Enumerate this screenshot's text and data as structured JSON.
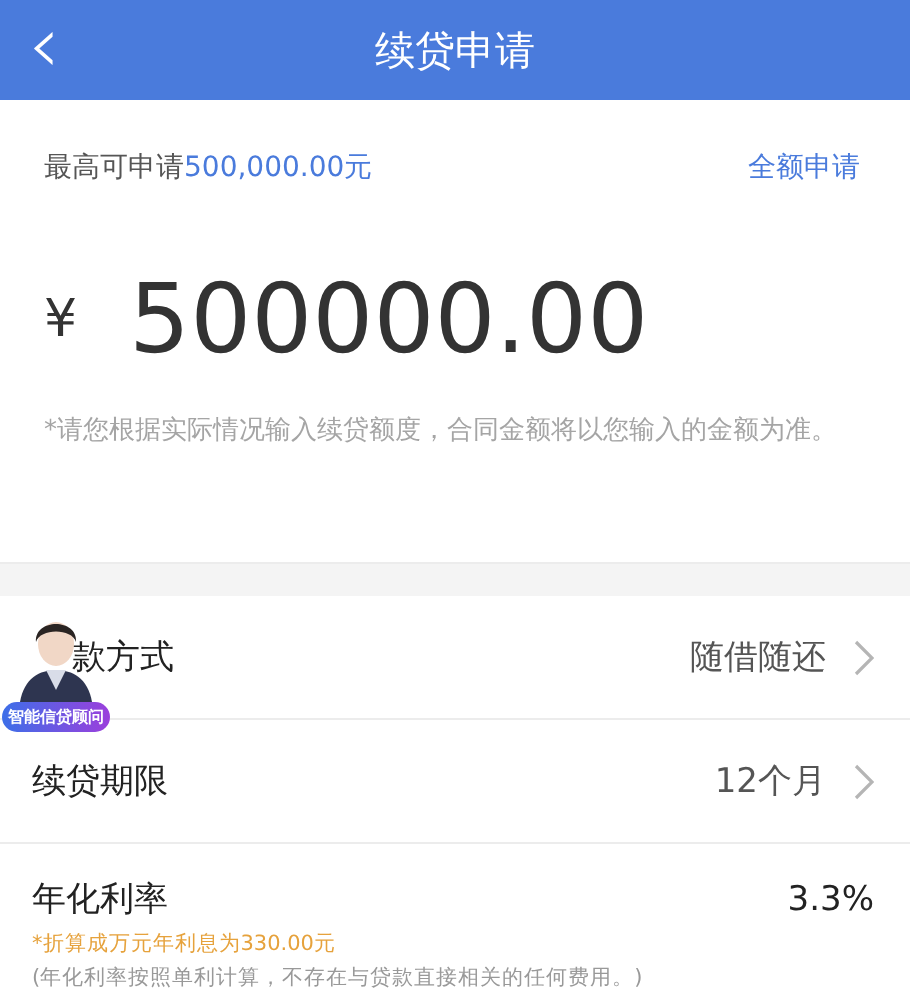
{
  "header": {
    "back_icon": "‹",
    "title": "续贷申请"
  },
  "limit": {
    "label": "最高可申请",
    "amount": "500,000.00元",
    "action": "全额申请"
  },
  "amount": {
    "currency": "¥",
    "value": "500000.00"
  },
  "note": "*请您根据实际情况输入续贷额度，合同金额将以您输入的金额为准。",
  "rows": [
    {
      "kind": "select",
      "label": "款方式",
      "value": "随借随还"
    },
    {
      "kind": "select",
      "label": "续贷期限",
      "value": "12个月"
    },
    {
      "kind": "rate",
      "label": "年化利率",
      "value": "3.3%",
      "hint": "*折算成万元年利息为330.00元",
      "footnote": "(年化利率按照单利计算，不存在与贷款直接相关的任何费用。)"
    }
  ],
  "assistant": {
    "badge": "智能信贷顾问"
  }
}
